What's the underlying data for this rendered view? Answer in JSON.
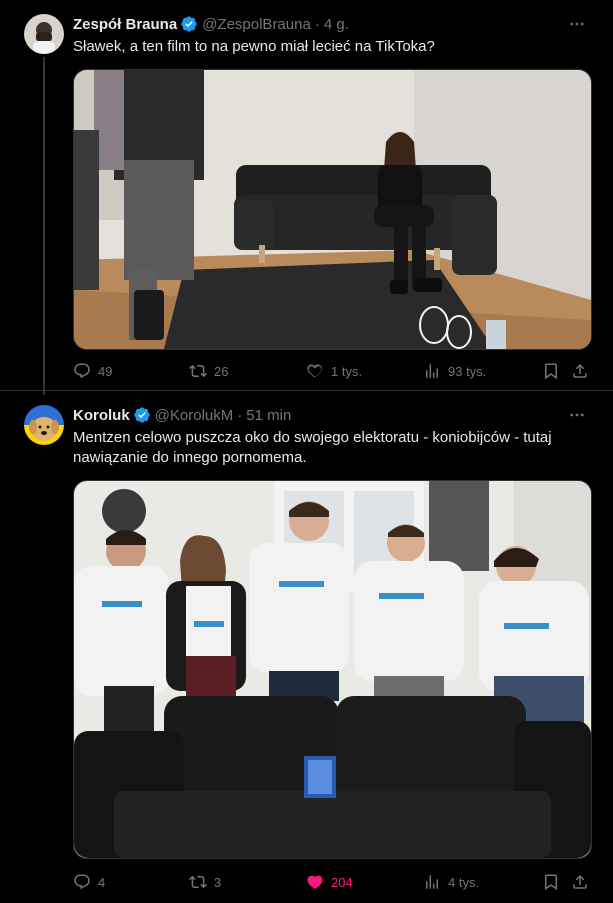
{
  "tweets": [
    {
      "author_name": "Zespół Brauna",
      "handle": "@ZespolBrauna",
      "separator": "·",
      "time": "4 g.",
      "text": "Sławek, a ten film to na pewno miał lecieć na TikToka?",
      "media_icon": "photo-office-couch-woman-seated",
      "stats": {
        "replies": "49",
        "retweets": "26",
        "likes": "1 tys.",
        "views": "93 tys."
      },
      "liked": false
    },
    {
      "author_name": "Koroluk",
      "handle": "@KorolukM",
      "separator": "·",
      "time": "51 min",
      "text": "Mentzen celowo puszcza oko do swojego elektoratu - koniobijców - tutaj nawiązanie do innego pornomema.",
      "media_icon": "photo-five-people-looking-at-couch",
      "stats": {
        "replies": "4",
        "retweets": "3",
        "likes": "204",
        "views": "4 tys."
      },
      "liked": true
    }
  ],
  "colors": {
    "background": "#000000",
    "text_primary": "#e7e9ea",
    "text_secondary": "#71767b",
    "verified": "#1d9bf0",
    "like_active": "#f91880",
    "border": "#2f3336"
  }
}
